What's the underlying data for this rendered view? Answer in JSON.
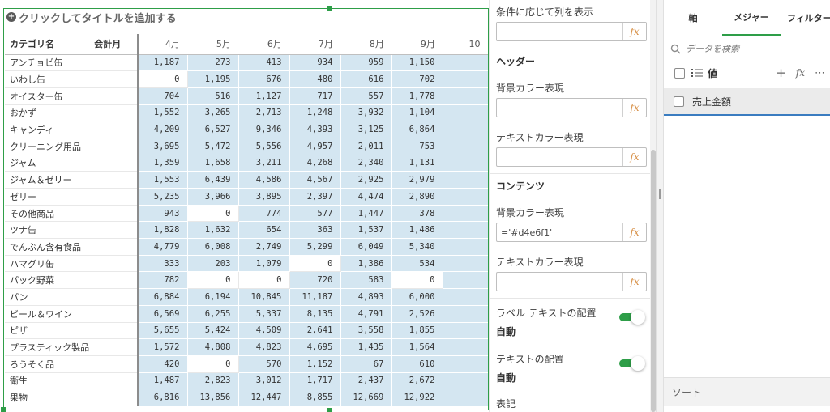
{
  "table": {
    "title_placeholder": "クリックしてタイトルを追加する",
    "dim_headers": [
      "カテゴリ名",
      "会計月"
    ],
    "months": [
      "4月",
      "5月",
      "6月",
      "7月",
      "8月",
      "9月",
      "10"
    ],
    "rows": [
      {
        "cat": "アンチョビ缶",
        "v": [
          "1,187",
          "273",
          "413",
          "934",
          "959",
          "1,150",
          ""
        ]
      },
      {
        "cat": "いわし缶",
        "v": [
          "0",
          "1,195",
          "676",
          "480",
          "616",
          "702",
          ""
        ]
      },
      {
        "cat": "オイスター缶",
        "v": [
          "704",
          "516",
          "1,127",
          "717",
          "557",
          "1,778",
          ""
        ]
      },
      {
        "cat": "おかず",
        "v": [
          "1,552",
          "3,265",
          "2,713",
          "1,248",
          "3,932",
          "1,104",
          ""
        ]
      },
      {
        "cat": "キャンディ",
        "v": [
          "4,209",
          "6,527",
          "9,346",
          "4,393",
          "3,125",
          "6,864",
          ""
        ]
      },
      {
        "cat": "クリーニング用品",
        "v": [
          "3,695",
          "5,472",
          "5,556",
          "4,957",
          "2,011",
          "753",
          ""
        ]
      },
      {
        "cat": "ジャム",
        "v": [
          "1,359",
          "1,658",
          "3,211",
          "4,268",
          "2,340",
          "1,131",
          ""
        ]
      },
      {
        "cat": "ジャム＆ゼリー",
        "v": [
          "1,553",
          "6,439",
          "4,586",
          "4,567",
          "2,925",
          "2,979",
          ""
        ]
      },
      {
        "cat": "ゼリー",
        "v": [
          "5,235",
          "3,966",
          "3,895",
          "2,397",
          "4,474",
          "2,890",
          ""
        ]
      },
      {
        "cat": "その他商品",
        "v": [
          "943",
          "0",
          "774",
          "577",
          "1,447",
          "378",
          ""
        ]
      },
      {
        "cat": "ツナ缶",
        "v": [
          "1,828",
          "1,632",
          "654",
          "363",
          "1,537",
          "1,486",
          ""
        ]
      },
      {
        "cat": "でんぷん含有食品",
        "v": [
          "4,779",
          "6,008",
          "2,749",
          "5,299",
          "6,049",
          "5,340",
          ""
        ]
      },
      {
        "cat": "ハマグリ缶",
        "v": [
          "333",
          "203",
          "1,079",
          "0",
          "1,386",
          "534",
          ""
        ]
      },
      {
        "cat": "パック野菜",
        "v": [
          "782",
          "0",
          "0",
          "720",
          "583",
          "0",
          ""
        ]
      },
      {
        "cat": "パン",
        "v": [
          "6,884",
          "6,194",
          "10,845",
          "11,187",
          "4,893",
          "6,000",
          ""
        ]
      },
      {
        "cat": "ビール＆ワイン",
        "v": [
          "6,569",
          "6,255",
          "5,337",
          "8,135",
          "4,791",
          "2,526",
          ""
        ]
      },
      {
        "cat": "ピザ",
        "v": [
          "5,655",
          "5,424",
          "4,509",
          "2,641",
          "3,558",
          "1,855",
          ""
        ]
      },
      {
        "cat": "プラスティック製品",
        "v": [
          "1,572",
          "4,808",
          "4,823",
          "4,695",
          "1,435",
          "1,564",
          ""
        ]
      },
      {
        "cat": "ろうそく品",
        "v": [
          "420",
          "0",
          "570",
          "1,152",
          "67",
          "610",
          ""
        ]
      },
      {
        "cat": "衛生",
        "v": [
          "1,487",
          "2,823",
          "3,012",
          "1,717",
          "2,437",
          "2,672",
          ""
        ]
      },
      {
        "cat": "果物",
        "v": [
          "6,816",
          "13,856",
          "12,447",
          "8,855",
          "12,669",
          "12,922",
          ""
        ]
      }
    ]
  },
  "properties": {
    "show_column_if": "条件に応じて列を表示",
    "header_title": "ヘッダー",
    "bg_color_expr": "背景カラー表現",
    "text_color_expr": "テキストカラー表現",
    "content_title": "コンテンツ",
    "content_bg_value": "='#d4e6f1'",
    "label_align": "ラベル テキストの配置",
    "label_align_value": "自動",
    "text_align": "テキストの配置",
    "text_align_value": "自動",
    "notation": "表記",
    "fx_label": "fx"
  },
  "fields": {
    "tabs": [
      "軸",
      "メジャー",
      "フィルター"
    ],
    "search_placeholder": "データを検索",
    "values_label": "値",
    "item_label": "売上金額",
    "sort_label": "ソート",
    "plus_glyph": "+",
    "more_glyph": "⋯"
  },
  "colors": {
    "accent": "#2e9e48",
    "cell_bg": "#d4e6f1",
    "fx": "#d8924a",
    "item_underline": "#3a7cc0"
  }
}
